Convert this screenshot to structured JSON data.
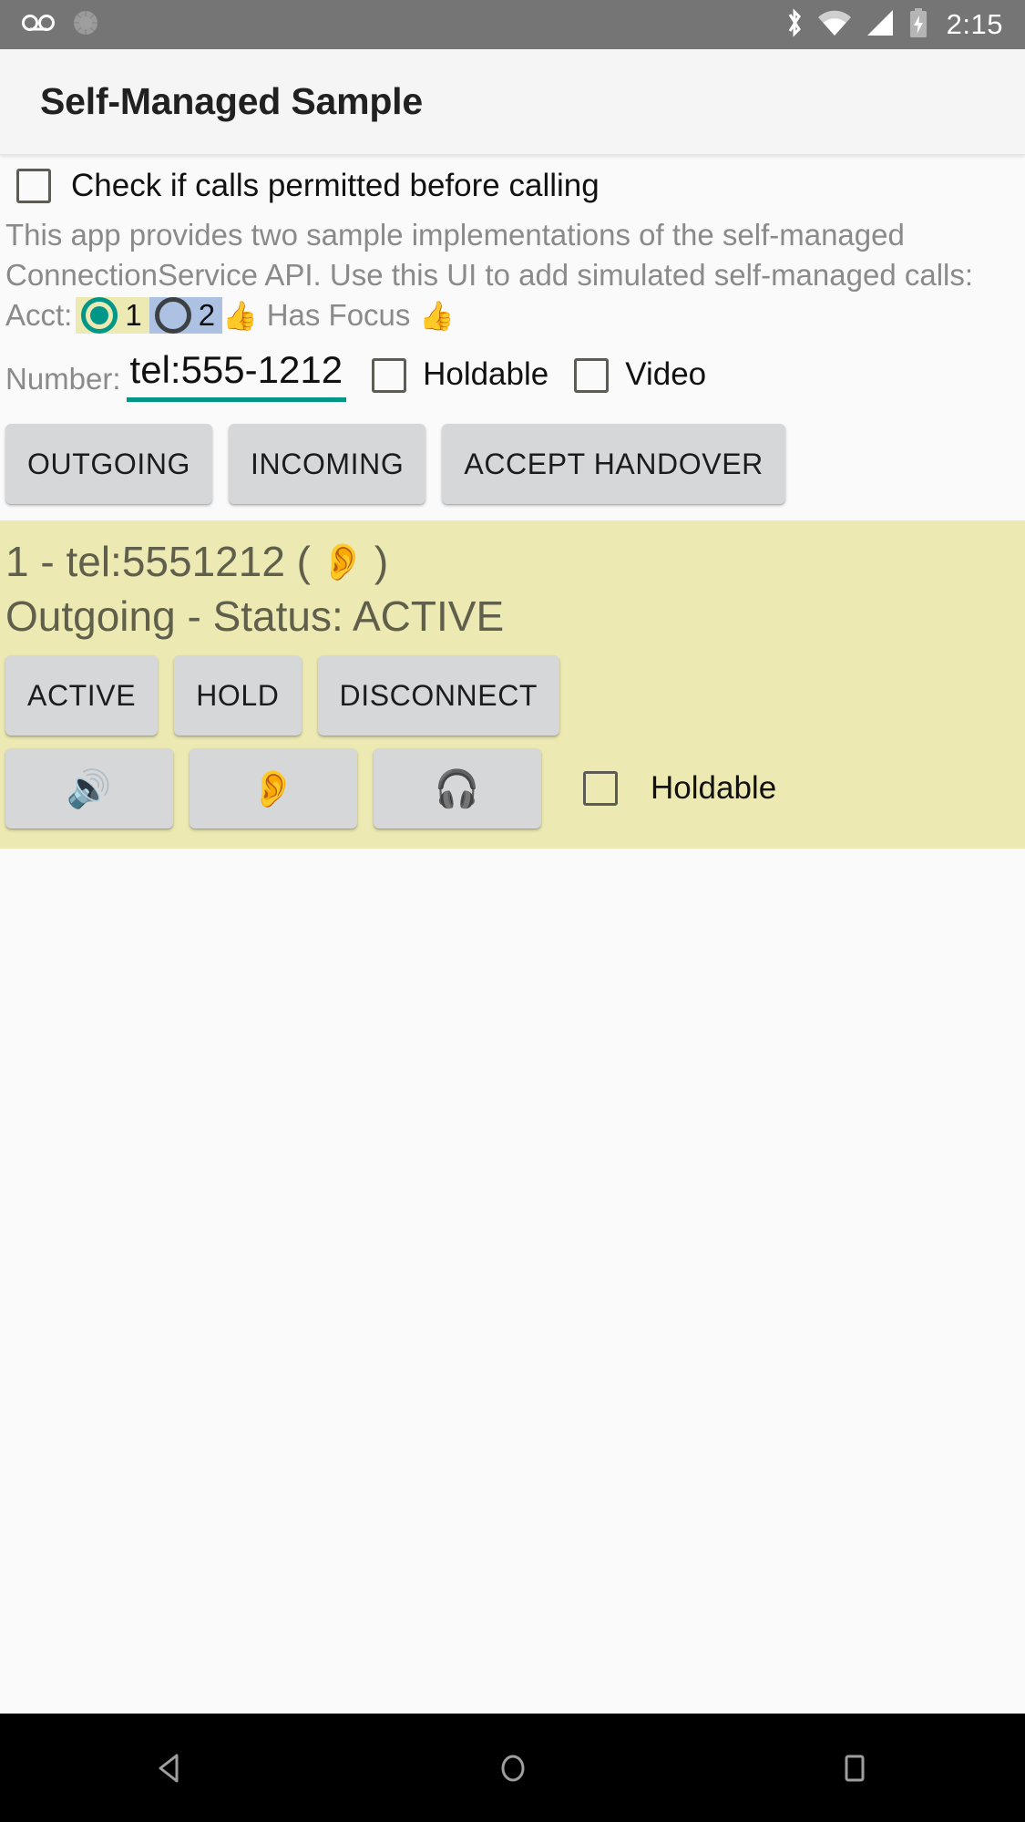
{
  "statusbar": {
    "icons": [
      "voicemail-icon",
      "sync-icon",
      "bluetooth-icon",
      "wifi-icon",
      "cell-signal-icon",
      "battery-charging-icon"
    ],
    "clock": "2:15"
  },
  "appbar": {
    "title": "Self-Managed Sample"
  },
  "permit": {
    "label": "Check if calls permitted before calling",
    "checked": false
  },
  "description": "This app provides two sample implementations of the self-managed ConnectionService API.  Use this UI to add simulated self-managed calls:",
  "account": {
    "label": "Acct:",
    "options": [
      {
        "value": "1",
        "selected": true,
        "highlight": "#ece9b3"
      },
      {
        "value": "2",
        "selected": false,
        "highlight": "#adc2e3"
      }
    ],
    "focus_emoji_left": "👍",
    "focus_text": "Has Focus",
    "focus_emoji_right": "👍"
  },
  "number": {
    "label": "Number:",
    "value": "tel:555-1212",
    "placeholder": "tel:555-1212",
    "holdable_label": "Holdable",
    "holdable_checked": false,
    "video_label": "Video",
    "video_checked": false
  },
  "actions": [
    {
      "label": "OUTGOING",
      "name": "outgoing-button"
    },
    {
      "label": "INCOMING",
      "name": "incoming-button"
    },
    {
      "label": "ACCEPT HANDOVER",
      "name": "accept-handover-button"
    }
  ],
  "call": {
    "background": "#ece9b3",
    "text_color": "#5f5f4c",
    "title_prefix": "1 - tel:5551212 (",
    "title_emoji": "👂",
    "title_suffix": ")",
    "status": "Outgoing - Status: ACTIVE",
    "state_buttons": [
      {
        "label": "ACTIVE",
        "name": "call-active-button"
      },
      {
        "label": "HOLD",
        "name": "call-hold-button"
      },
      {
        "label": "DISCONNECT",
        "name": "call-disconnect-button"
      }
    ],
    "audio_buttons": [
      {
        "emoji": "🔊",
        "name": "audio-route-speaker-button"
      },
      {
        "emoji": "👂",
        "name": "audio-route-earpiece-button"
      },
      {
        "emoji": "🎧",
        "name": "audio-route-headset-button"
      }
    ],
    "holdable_label": "Holdable",
    "holdable_checked": false
  },
  "navbar": {
    "back_label": "Back",
    "home_label": "Home",
    "recents_label": "Recents"
  }
}
